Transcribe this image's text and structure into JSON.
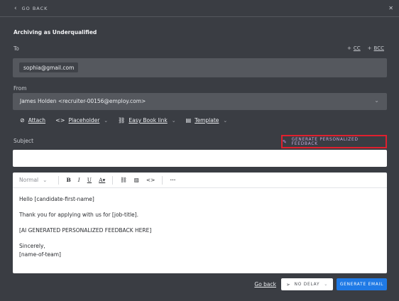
{
  "topbar": {
    "back_label": "GO BACK",
    "back_icon": "chevron-left-icon",
    "close_icon": "close-icon"
  },
  "heading": "Archiving as Underqualified",
  "to": {
    "label": "To",
    "cc_label": "CC",
    "bcc_label": "BCC",
    "recipient": "sophia@gmail.com"
  },
  "from": {
    "label": "From",
    "value": "James Holden <recruiter-00156@employ.com>"
  },
  "toolbar": {
    "attach": "Attach",
    "placeholder": "Placeholder",
    "easy_book": "Easy Book link",
    "template": "Template"
  },
  "subject": {
    "label": "Subject",
    "value": ""
  },
  "generate_button": "GENERATE PERSONALIZED FEEDBACK",
  "editor": {
    "style": "Normal",
    "lines": [
      "Hello [candidate-first-name]",
      "Thank you for applying with us for [job-title].",
      "[AI GENERATED PERSONALIZED FEEDBACK HERE]",
      "Sincerely,",
      "[name-of-team]"
    ]
  },
  "footer": {
    "go_back": "Go back",
    "delay": "NO DELAY",
    "send": "GENERATE EMAIL"
  },
  "colors": {
    "accent": "#1f7ae6",
    "highlight_border": "#e0202e",
    "background": "#3a3d43"
  }
}
